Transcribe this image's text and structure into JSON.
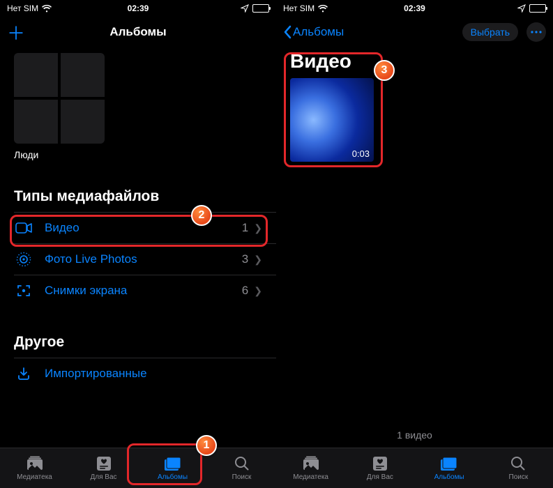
{
  "status": {
    "sim": "Нет SIM",
    "time": "02:39"
  },
  "left": {
    "title": "Альбомы",
    "people_label": "Люди",
    "section_media_types": "Типы медиафайлов",
    "section_other": "Другое",
    "rows": {
      "video": {
        "label": "Видео",
        "count": "1"
      },
      "live": {
        "label": "Фото Live Photos",
        "count": "3"
      },
      "shots": {
        "label": "Снимки экрана",
        "count": "6"
      },
      "imported": {
        "label": "Импортированные"
      }
    }
  },
  "right": {
    "back_label": "Альбомы",
    "select_label": "Выбрать",
    "title": "Видео",
    "duration": "0:03",
    "footer_count": "1 видео"
  },
  "tabs": [
    {
      "label": "Медиатека"
    },
    {
      "label": "Для Вас"
    },
    {
      "label": "Альбомы"
    },
    {
      "label": "Поиск"
    }
  ],
  "callouts": {
    "b1": "1",
    "b2": "2",
    "b3": "3"
  }
}
